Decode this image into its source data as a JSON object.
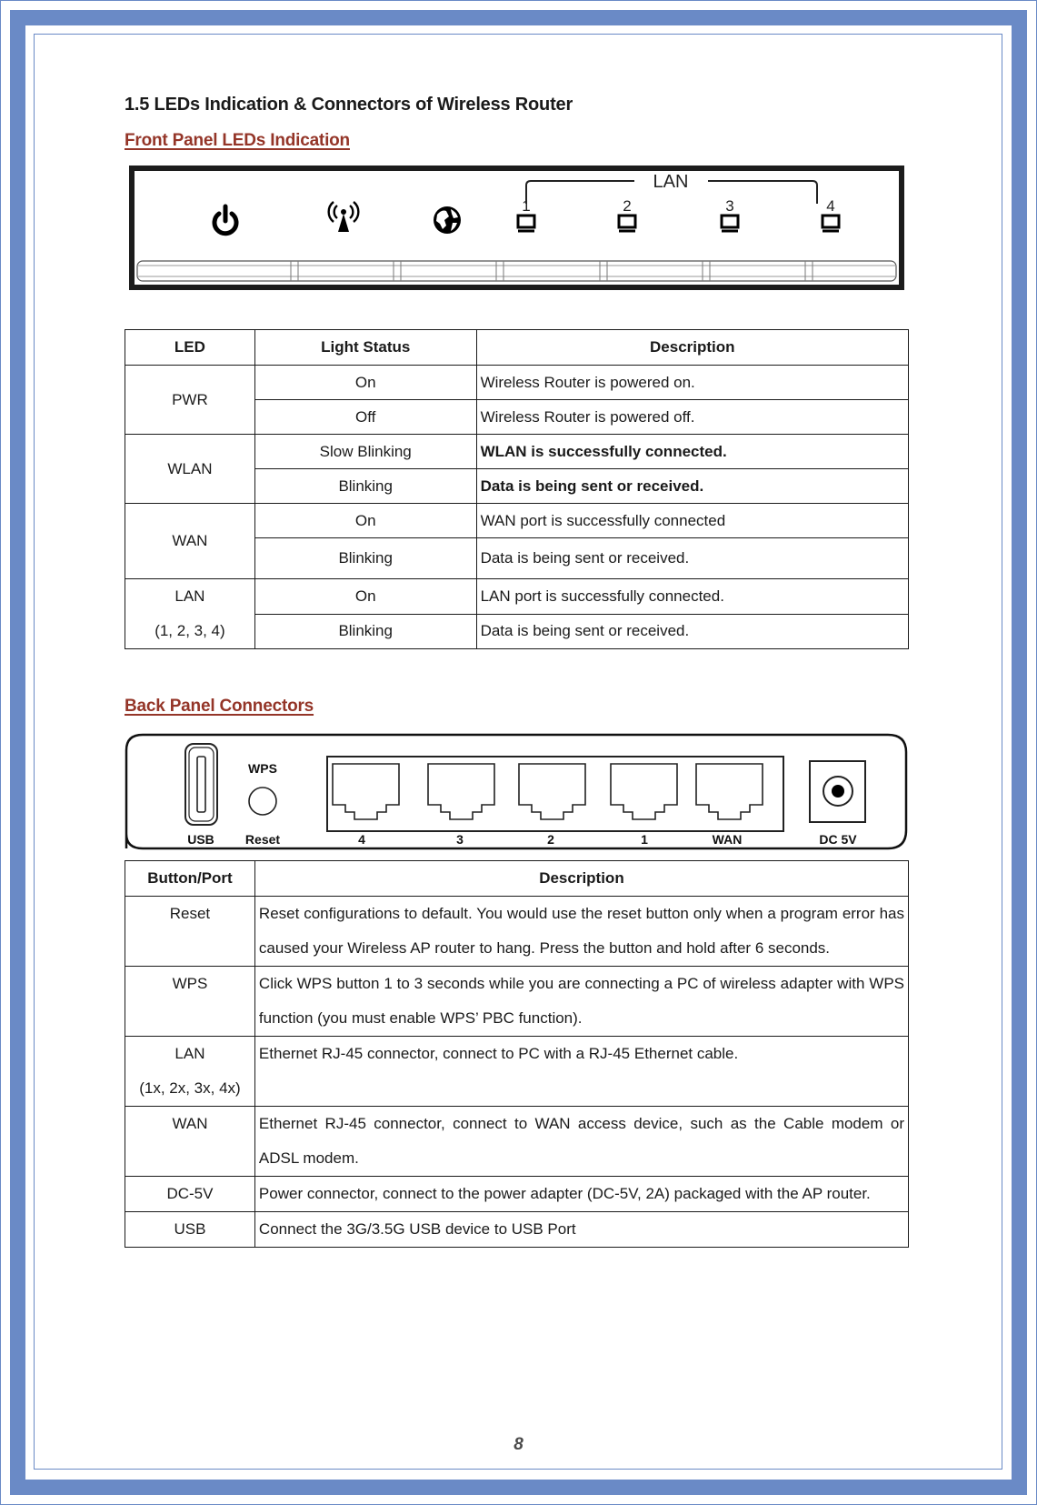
{
  "page": {
    "title": "1.5 LEDs Indication & Connectors of Wireless Router",
    "page_number": "8",
    "colors": {
      "frame": "#6a8ac6",
      "heading_link": "#943528",
      "text": "#1a1a1a"
    }
  },
  "front_panel": {
    "heading": "Front Panel LEDs Indication",
    "image": {
      "group_label": "LAN",
      "icons": [
        "power-icon",
        "wireless-antenna-icon",
        "globe-icon",
        "lan-port-icon",
        "lan-port-icon",
        "lan-port-icon",
        "lan-port-icon"
      ],
      "lan_numbers": [
        "1",
        "2",
        "3",
        "4"
      ]
    }
  },
  "led_table": {
    "headers": [
      "LED",
      "Light Status",
      "Description"
    ],
    "groups": [
      {
        "led": "PWR",
        "led_sub": "",
        "rows": [
          {
            "status": "On",
            "description": "Wireless Router is powered on.",
            "bold": false
          },
          {
            "status": "Off",
            "description": "Wireless Router is powered off.",
            "bold": false
          }
        ]
      },
      {
        "led": "WLAN",
        "led_sub": "",
        "rows": [
          {
            "status": "Slow Blinking",
            "description": "WLAN is successfully connected.",
            "bold": true
          },
          {
            "status": "Blinking",
            "description": "Data is being sent or received.",
            "bold": true
          }
        ]
      },
      {
        "led": "WAN",
        "led_sub": "",
        "rows": [
          {
            "status": "On",
            "description": "WAN port is successfully connected",
            "bold": false
          },
          {
            "status": "Blinking",
            "description": "Data is being sent or received.",
            "bold": false
          }
        ]
      },
      {
        "led": "LAN",
        "led_sub": "(1, 2, 3, 4)",
        "rows": [
          {
            "status": "On",
            "description": "LAN port is successfully connected.",
            "bold": false
          },
          {
            "status": "Blinking",
            "description": "Data is being sent or received.",
            "bold": false
          }
        ]
      }
    ]
  },
  "back_panel": {
    "heading": "Back Panel Connectors",
    "image": {
      "labels": {
        "usb": "USB",
        "wps": "WPS",
        "reset": "Reset",
        "port4": "4",
        "port3": "3",
        "port2": "2",
        "port1": "1",
        "wan": "WAN",
        "dc": "DC 5V"
      }
    }
  },
  "connector_table": {
    "headers": [
      "Button/Port",
      "Description"
    ],
    "rows": [
      {
        "port": "Reset",
        "port_sub": "",
        "description": "Reset configurations to default. You would use the reset button only when a program error has caused your Wireless AP router to hang. Press the button and hold after 6 seconds."
      },
      {
        "port": "WPS",
        "port_sub": "",
        "description": "Click WPS button 1 to 3 seconds while you are connecting a PC of wireless adapter with WPS function (you must enable WPS’ PBC function)."
      },
      {
        "port": "LAN",
        "port_sub": "(1x, 2x, 3x, 4x)",
        "description": "Ethernet RJ-45 connector, connect to PC with a RJ-45 Ethernet cable."
      },
      {
        "port": "WAN",
        "port_sub": "",
        "description": "Ethernet RJ-45 connector, connect to WAN access device, such as the Cable modem or ADSL modem."
      },
      {
        "port": "DC-5V",
        "port_sub": "",
        "description": "Power connector, connect to the power adapter (DC-5V, 2A) packaged with the AP router."
      },
      {
        "port": "USB",
        "port_sub": "",
        "description": "Connect the 3G/3.5G USB device to USB Port"
      }
    ]
  }
}
